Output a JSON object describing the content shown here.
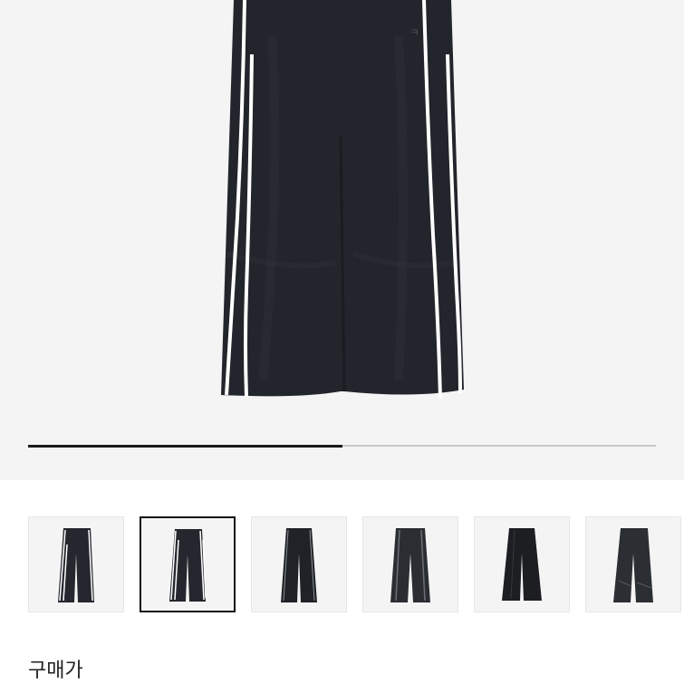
{
  "product": {
    "main_image_icon": "track-pants-image",
    "image_description_icon": "wide-leg-track-pants-with-white-side-piping"
  },
  "carousel": {
    "progress_fraction": 0.5,
    "track_color": "#c8c8c8",
    "fill_color": "#1a1a1a"
  },
  "thumbnails": {
    "selected_index": 1,
    "items": [
      {
        "icon": "pants-thumbnail-1"
      },
      {
        "icon": "pants-thumbnail-2"
      },
      {
        "icon": "pants-thumbnail-3"
      },
      {
        "icon": "pants-thumbnail-4"
      },
      {
        "icon": "pants-thumbnail-5"
      },
      {
        "icon": "pants-thumbnail-6"
      }
    ]
  },
  "price_section": {
    "label": "구매가"
  },
  "colors": {
    "hero_background": "#f4f4f4",
    "pants": "#22252b",
    "piping": "#ffffff"
  }
}
